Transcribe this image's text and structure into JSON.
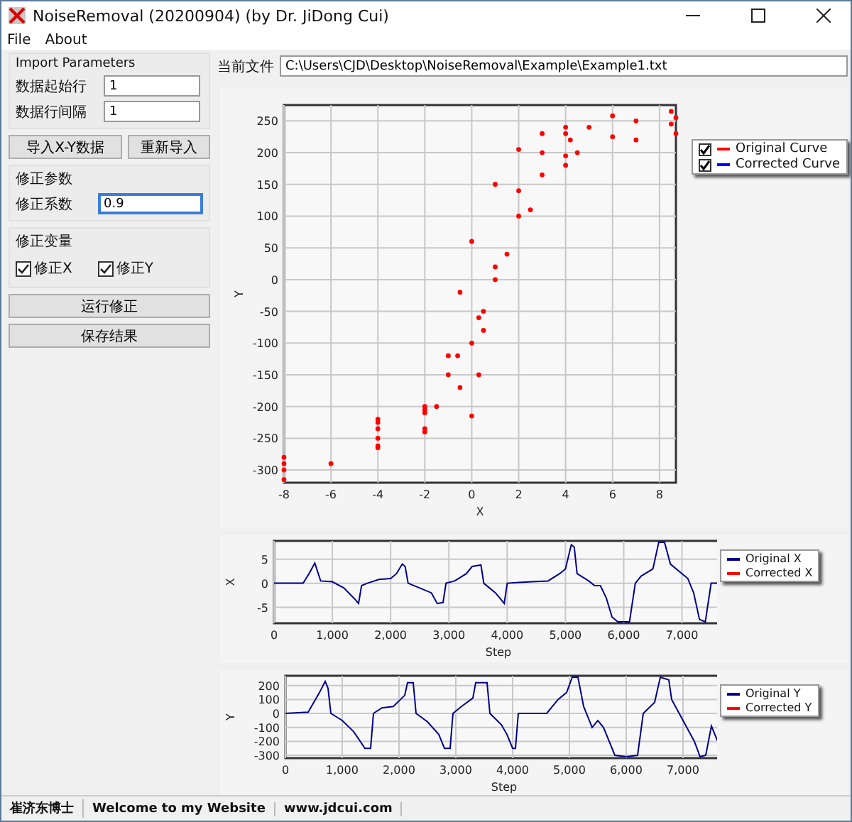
{
  "window": {
    "title": "NoiseRemoval (20200904) (by Dr. JiDong Cui)"
  },
  "menu": [
    {
      "label": "File"
    },
    {
      "label": "About"
    }
  ],
  "import_parameters": {
    "title": "Import Parameters",
    "fields": [
      {
        "label": "数据起始行",
        "value": "1"
      },
      {
        "label": "数据行间隔",
        "value": "1"
      }
    ]
  },
  "import_buttons": [
    "导入X-Y数据",
    "重新导入"
  ],
  "correction_parameters": {
    "title": "修正参数",
    "label": "修正系数",
    "value": "0.9",
    "focused": true
  },
  "correction_variables": {
    "title": "修正变量",
    "options": [
      {
        "label": "修正X",
        "checked": true
      },
      {
        "label": "修正Y",
        "checked": true
      }
    ]
  },
  "action_buttons": [
    "运行修正",
    "保存结果"
  ],
  "current_file": {
    "label": "当前文件",
    "value": "C:\\Users\\CJD\\Desktop\\NoiseRemoval\\Example\\Example1.txt"
  },
  "charts": [
    {
      "series_checked": [
        true
      ],
      "legend": [
        {
          "label": "Corrected Curve",
          "color": "#0000ff",
          "checked": true
        }
      ],
      "chart_data": {
        "type": "scatter",
        "grid": true,
        "xlabel": "X",
        "ylabel": "Y",
        "xlim": [
          -8,
          8.7
        ],
        "ylim": [
          -320,
          275
        ],
        "xticks": [
          -8,
          -6,
          -4,
          -2,
          0,
          2,
          4,
          6,
          8
        ],
        "yticks": [
          -300,
          -250,
          -200,
          -150,
          -100,
          -50,
          0,
          50,
          100,
          150,
          200,
          250
        ],
        "x": [
          -8,
          -6,
          -4,
          -4,
          -2,
          -1.5,
          -1,
          -0.6,
          0,
          0.3,
          1,
          2,
          3,
          4,
          6,
          8.5,
          8.5,
          6,
          4,
          3,
          2,
          1,
          0,
          -0.5,
          -1,
          -2,
          -2,
          -4,
          -4,
          -8,
          -8,
          -4,
          -2,
          0,
          0.3,
          0.5,
          1,
          2,
          3,
          4,
          4.2,
          5,
          7,
          8.7,
          8.7,
          7,
          4.5,
          4,
          2.5,
          1.5,
          0.5,
          -0.5,
          -2,
          -4,
          -8
        ],
        "series": [
          {
            "name": "Original Curve",
            "color": "#ff0000",
            "values": [
              -315,
              -290,
              -262,
              -225,
              -235,
              -200,
              -150,
              -120,
              -100,
              -60,
              0,
              100,
              165,
              195,
              225,
              245,
              265,
              258,
              240,
              230,
              205,
              150,
              60,
              -20,
              -120,
              -200,
              -205,
              -220,
              -250,
              -280,
              -300,
              -265,
              -240,
              -215,
              -150,
              -50,
              20,
              140,
              200,
              230,
              220,
              240,
              250,
              255,
              230,
              220,
              200,
              180,
              110,
              40,
              -80,
              -170,
              -210,
              -235,
              -290
            ]
          }
        ]
      }
    },
    {
      "legend": [
        {
          "label": "Corrected X",
          "color": "#ff0000"
        }
      ],
      "chart_data": {
        "type": "line",
        "grid": true,
        "xlabel": "Step",
        "ylabel": "X",
        "xlim": [
          0,
          7700
        ],
        "ylim": [
          -8.3,
          8.8
        ],
        "xticks": [
          {
            "value": 0,
            "label": "0"
          },
          {
            "value": 1000,
            "label": "1,000"
          },
          {
            "value": 2000,
            "label": "2,000"
          },
          {
            "value": 3000,
            "label": "3,000"
          },
          {
            "value": 4000,
            "label": "4,000"
          },
          {
            "value": 5000,
            "label": "5,000"
          },
          {
            "value": 6000,
            "label": "6,000"
          },
          {
            "value": 7000,
            "label": "7,000"
          }
        ],
        "yticks": [
          -5,
          0,
          5
        ],
        "x": [
          0,
          500,
          600,
          700,
          800,
          1000,
          1200,
          1400,
          1450,
          1500,
          1600,
          1800,
          2000,
          2100,
          2200,
          2250,
          2300,
          2500,
          2700,
          2800,
          2900,
          2950,
          3100,
          3300,
          3400,
          3550,
          3600,
          3800,
          3950,
          4000,
          4200,
          4700,
          4900,
          5000,
          5100,
          5150,
          5200,
          5400,
          5500,
          5600,
          5700,
          5800,
          5900,
          6100,
          6200,
          6300,
          6500,
          6600,
          6700,
          6800,
          7000,
          7100,
          7200,
          7300,
          7400,
          7500,
          7700
        ],
        "series": [
          {
            "name": "Original X",
            "color": "#00008b",
            "values": [
              0,
              0,
              2,
              4.2,
              0.5,
              0.3,
              -1,
              -3.5,
              -4.2,
              -0.5,
              0,
              0.8,
              1,
              2,
              4,
              3.5,
              0,
              -1,
              -2,
              -4.2,
              -4,
              0,
              0.5,
              2,
              3.5,
              3.8,
              0,
              -2,
              -4.2,
              0,
              0.2,
              0.5,
              2,
              3,
              8,
              7.5,
              2,
              0.5,
              -0.5,
              -0.5,
              -3,
              -7,
              -8,
              -8,
              0,
              1.5,
              3,
              8.5,
              8.5,
              4,
              2,
              1,
              -2,
              -7.5,
              -8,
              0,
              0
            ]
          }
        ]
      }
    },
    {
      "legend": [
        {
          "label": "Corrected Y",
          "color": "#ff0000"
        }
      ],
      "chart_data": {
        "type": "line",
        "grid": true,
        "xlabel": "Step",
        "ylabel": "Y",
        "xlim": [
          0,
          7700
        ],
        "ylim": [
          -320,
          270
        ],
        "xticks": [
          {
            "value": 0,
            "label": "0"
          },
          {
            "value": 1000,
            "label": "1,000"
          },
          {
            "value": 2000,
            "label": "2,000"
          },
          {
            "value": 3000,
            "label": "3,000"
          },
          {
            "value": 4000,
            "label": "4,000"
          },
          {
            "value": 5000,
            "label": "5,000"
          },
          {
            "value": 6000,
            "label": "6,000"
          },
          {
            "value": 7000,
            "label": "7,000"
          }
        ],
        "yticks": [
          -300,
          -200,
          -100,
          0,
          100,
          200
        ],
        "x": [
          0,
          400,
          600,
          700,
          750,
          800,
          1000,
          1200,
          1400,
          1500,
          1550,
          1700,
          1900,
          2100,
          2150,
          2250,
          2300,
          2500,
          2700,
          2800,
          2900,
          2950,
          3100,
          3300,
          3350,
          3550,
          3600,
          3800,
          3900,
          4000,
          4050,
          4100,
          4600,
          4800,
          4950,
          5050,
          5150,
          5250,
          5400,
          5500,
          5600,
          5700,
          5800,
          6000,
          6200,
          6300,
          6500,
          6600,
          6750,
          6800,
          7000,
          7200,
          7300,
          7400,
          7500,
          7600,
          7660
        ],
        "series": [
          {
            "name": "Original Y",
            "color": "#00008b",
            "values": [
              0,
              10,
              150,
              230,
              180,
              0,
              -50,
              -130,
              -250,
              -250,
              0,
              40,
              50,
              130,
              220,
              220,
              0,
              -60,
              -150,
              -250,
              -250,
              0,
              50,
              110,
              220,
              220,
              0,
              -80,
              -150,
              -250,
              -250,
              0,
              0,
              100,
              150,
              260,
              260,
              50,
              -100,
              -50,
              -100,
              -200,
              -300,
              -310,
              -300,
              0,
              80,
              260,
              240,
              100,
              -50,
              -200,
              -310,
              -300,
              -90,
              -190,
              -200
            ]
          }
        ]
      }
    }
  ],
  "status_bar": [
    "崔济东博士",
    "Welcome to my Website",
    "www.jdcui.com"
  ]
}
